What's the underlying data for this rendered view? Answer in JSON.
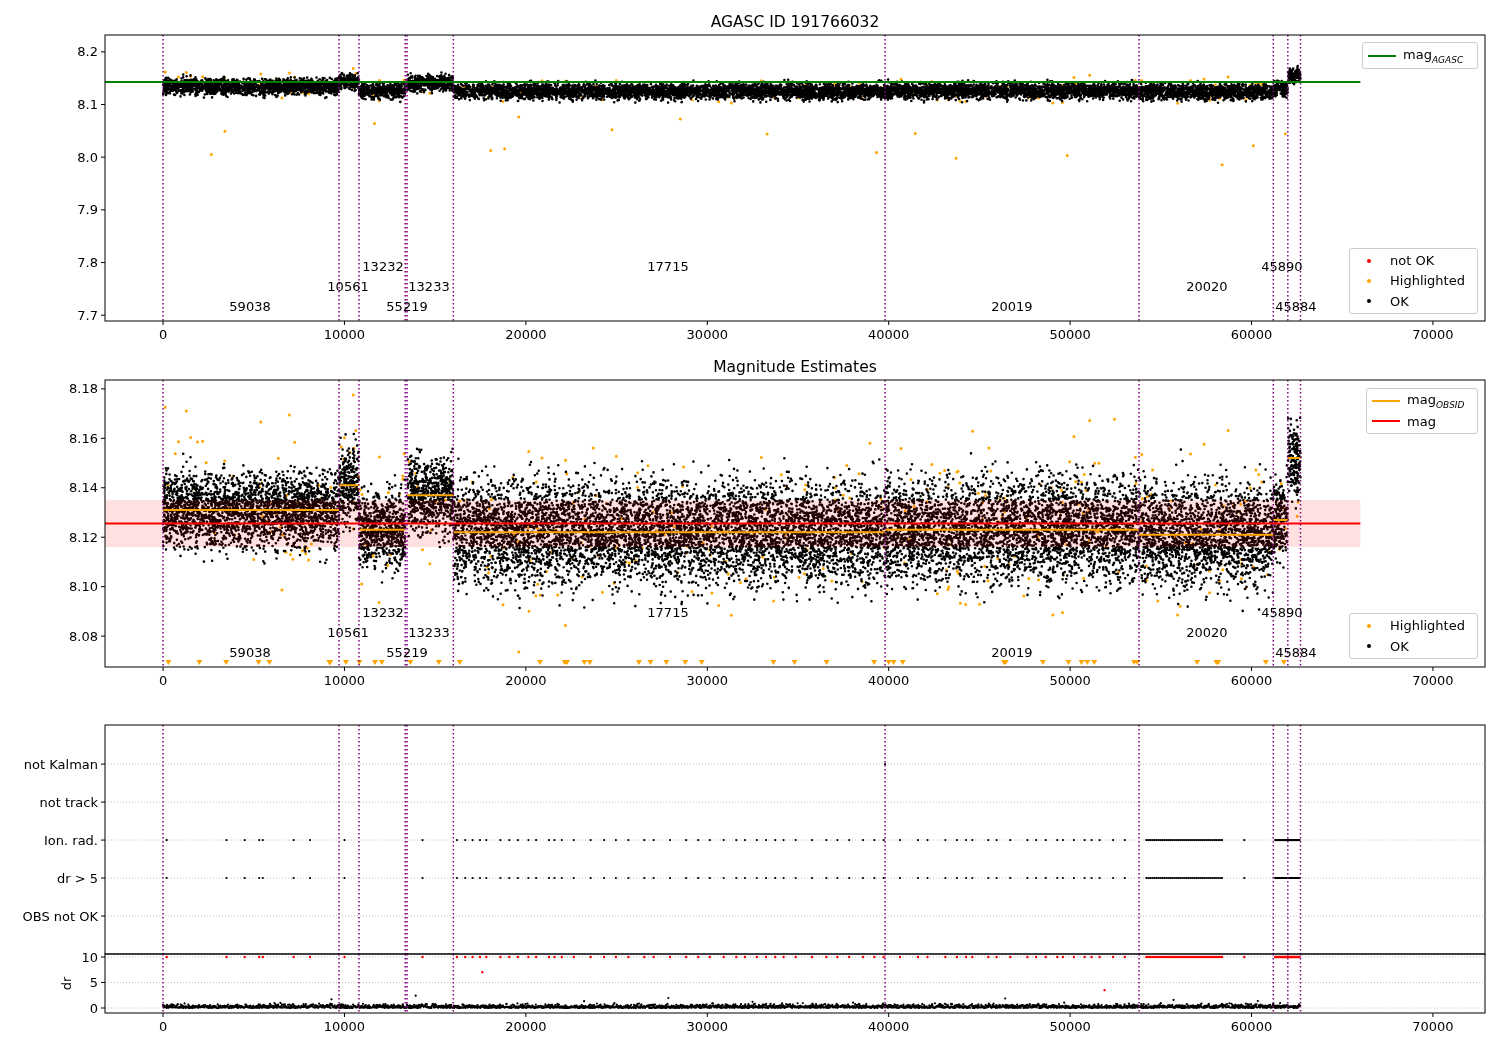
{
  "figure": {
    "panels": [
      {
        "chart_data": {
          "type": "scatter",
          "title": "AGASC ID 191766032",
          "xlim": [
            -3200,
            72870
          ],
          "ylim": [
            7.689,
            8.232
          ],
          "xticks": [
            0,
            10000,
            20000,
            30000,
            40000,
            50000,
            60000,
            70000
          ],
          "yticks": [
            7.7,
            7.8,
            7.9,
            {
              "value": 8.0,
              "label": "8.0"
            },
            8.1,
            8.2
          ],
          "legend": "upper right",
          "series": [
            {
              "name": "mag$_{AGASC}$",
              "type": "line",
              "color": "#008000",
              "x": [
                -3200,
                66000
              ],
              "values": [
                8.143,
                8.143
              ]
            }
          ],
          "ref_lines": [
            {
              "axis": "x",
              "value": 0,
              "color": "#800080"
            },
            {
              "axis": "x",
              "value": 9700,
              "color": "#800080"
            },
            {
              "axis": "x",
              "value": 10800,
              "color": "#800080"
            },
            {
              "axis": "x",
              "value": 13350,
              "color": "#800080"
            },
            {
              "axis": "x",
              "value": 13450,
              "color": "#800080"
            },
            {
              "axis": "x",
              "value": 16000,
              "color": "#800080"
            },
            {
              "axis": "x",
              "value": 39800,
              "color": "#800080"
            },
            {
              "axis": "x",
              "value": 53800,
              "color": "#800080"
            },
            {
              "axis": "x",
              "value": 61200,
              "color": "#800080"
            },
            {
              "axis": "x",
              "value": 62000,
              "color": "#800080"
            },
            {
              "axis": "x",
              "value": 62700,
              "color": "#800080"
            }
          ],
          "annotations": [
            "59038",
            "10561",
            "13232",
            "55219",
            "13233",
            "17715",
            "20019",
            "20020",
            "45890",
            "45884"
          ]
        },
        "legend_markers": [
          {
            "label": "not OK",
            "color": "#ff0000"
          },
          {
            "label": "Highlighted",
            "color": "#ffa500"
          },
          {
            "label": "OK",
            "color": "#000000"
          }
        ]
      },
      {
        "chart_data": {
          "type": "scatter",
          "title": "Magnitude Estimates",
          "xlim": [
            -3200,
            72870
          ],
          "ylim": [
            8.0675,
            8.1836
          ],
          "xticks": [
            0,
            10000,
            20000,
            30000,
            40000,
            50000,
            60000,
            70000
          ],
          "yticks": [
            {
              "value": 8.08,
              "label": "8.08"
            },
            {
              "value": 8.1,
              "label": "8.10"
            },
            {
              "value": 8.12,
              "label": "8.12"
            },
            {
              "value": 8.14,
              "label": "8.14"
            },
            {
              "value": 8.16,
              "label": "8.16"
            },
            {
              "value": 8.18,
              "label": "8.18"
            }
          ],
          "legend": "upper right",
          "series": [
            {
              "name": "mag$_{OBSID}$",
              "type": "line",
              "color": "#ffa500",
              "x": [
                0,
                9700,
                null,
                9700,
                10800,
                null,
                10800,
                13350,
                null,
                13450,
                16000,
                null,
                16000,
                39800,
                null,
                39800,
                53800,
                null,
                53800,
                61200,
                null,
                61200,
                62000,
                null,
                62000,
                62700
              ],
              "values": [
                8.131,
                8.131,
                null,
                8.141,
                8.141,
                null,
                8.123,
                8.123,
                null,
                8.137,
                8.137,
                null,
                8.122,
                8.122,
                null,
                8.123,
                8.123,
                null,
                8.121,
                8.121,
                null,
                8.127,
                8.127,
                null,
                8.152,
                8.152
              ]
            },
            {
              "name": "mag",
              "type": "line",
              "color": "#ff0000",
              "x": [
                -3200,
                66000
              ],
              "values": [
                8.1255,
                8.1255
              ]
            }
          ],
          "bands": [
            {
              "axis": "y",
              "from": 8.116,
              "to": 8.135,
              "color": "#ff0000"
            }
          ],
          "ref_lines": [
            {
              "axis": "x",
              "value": 0,
              "color": "#800080"
            },
            {
              "axis": "x",
              "value": 9700,
              "color": "#800080"
            },
            {
              "axis": "x",
              "value": 10800,
              "color": "#800080"
            },
            {
              "axis": "x",
              "value": 13350,
              "color": "#800080"
            },
            {
              "axis": "x",
              "value": 13450,
              "color": "#800080"
            },
            {
              "axis": "x",
              "value": 16000,
              "color": "#800080"
            },
            {
              "axis": "x",
              "value": 39800,
              "color": "#800080"
            },
            {
              "axis": "x",
              "value": 53800,
              "color": "#800080"
            },
            {
              "axis": "x",
              "value": 61200,
              "color": "#800080"
            },
            {
              "axis": "x",
              "value": 62000,
              "color": "#800080"
            },
            {
              "axis": "x",
              "value": 62700,
              "color": "#800080"
            }
          ],
          "annotations": [
            "59038",
            "10561",
            "13232",
            "55219",
            "13233",
            "17715",
            "20019",
            "20020",
            "45890",
            "45884"
          ]
        },
        "legend_markers": [
          {
            "label": "Highlighted",
            "color": "#ffa500"
          },
          {
            "label": "OK",
            "color": "#000000"
          }
        ]
      },
      {
        "chart_data": {
          "type": "scatter",
          "orientation": "horizontal",
          "grid": true,
          "xlim": [
            -3200,
            72870
          ],
          "categories": [
            "not Kalman",
            "not track",
            "Ion. rad.",
            "dr > 5",
            "OBS not OK"
          ],
          "ref_lines": [
            {
              "axis": "x",
              "value": 0,
              "color": "#800080"
            },
            {
              "axis": "x",
              "value": 9700,
              "color": "#800080"
            },
            {
              "axis": "x",
              "value": 10800,
              "color": "#800080"
            },
            {
              "axis": "x",
              "value": 13350,
              "color": "#800080"
            },
            {
              "axis": "x",
              "value": 13450,
              "color": "#800080"
            },
            {
              "axis": "x",
              "value": 16000,
              "color": "#800080"
            },
            {
              "axis": "x",
              "value": 39800,
              "color": "#800080"
            },
            {
              "axis": "x",
              "value": 53800,
              "color": "#800080"
            },
            {
              "axis": "x",
              "value": 61200,
              "color": "#800080"
            },
            {
              "axis": "x",
              "value": 62000,
              "color": "#800080"
            },
            {
              "axis": "x",
              "value": 62700,
              "color": "#800080"
            }
          ]
        }
      },
      {
        "chart_data": {
          "type": "scatter",
          "ylabel": "dr",
          "grid": true,
          "xlim": [
            -3200,
            72870
          ],
          "ylim": [
            -0.98,
            10.59
          ],
          "xticks": [
            0,
            10000,
            20000,
            30000,
            40000,
            50000,
            60000,
            70000
          ],
          "yticks": [
            0,
            5,
            10
          ],
          "ref_lines": [
            {
              "axis": "x",
              "value": 0,
              "color": "#800080"
            },
            {
              "axis": "x",
              "value": 9700,
              "color": "#800080"
            },
            {
              "axis": "x",
              "value": 10800,
              "color": "#800080"
            },
            {
              "axis": "x",
              "value": 13350,
              "color": "#800080"
            },
            {
              "axis": "x",
              "value": 13450,
              "color": "#800080"
            },
            {
              "axis": "x",
              "value": 16000,
              "color": "#800080"
            },
            {
              "axis": "x",
              "value": 39800,
              "color": "#800080"
            },
            {
              "axis": "x",
              "value": 53800,
              "color": "#800080"
            },
            {
              "axis": "x",
              "value": 61200,
              "color": "#800080"
            },
            {
              "axis": "x",
              "value": 62000,
              "color": "#800080"
            },
            {
              "axis": "x",
              "value": 62700,
              "color": "#800080"
            }
          ]
        }
      }
    ]
  }
}
